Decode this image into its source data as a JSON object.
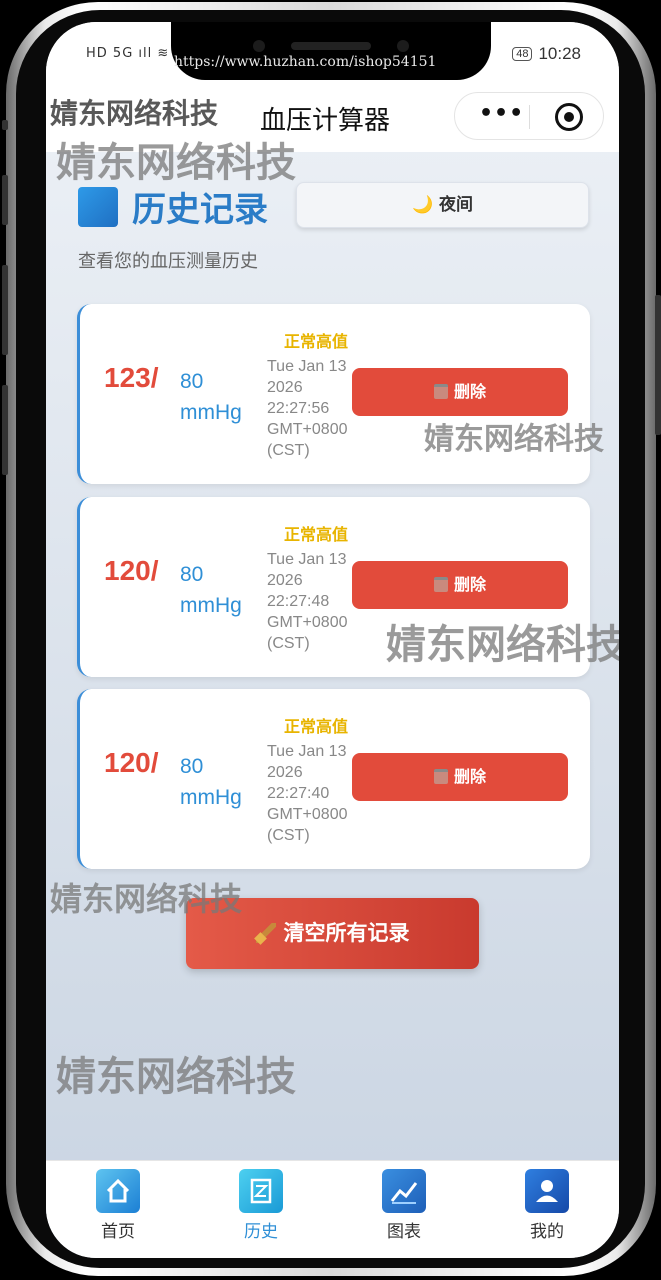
{
  "status_bar": {
    "left_icons": "HD 5G ıll ≋",
    "battery": "48",
    "time": "10:28"
  },
  "url_overlay": "https://www.huzhan.com/ishop54151",
  "app": {
    "brand_watermark": "婧东网络科技",
    "title": "血压计算器",
    "capsule_more": "•••"
  },
  "page": {
    "title": "历史记录",
    "night_toggle": "🌙 夜间",
    "subtitle": "查看您的血压测量历史"
  },
  "records": [
    {
      "systolic": "123/",
      "diastolic": "80",
      "unit": "mmHg",
      "status": "正常高值",
      "time": "Tue Jan 13 2026 22:27:56 GMT+0800 (CST)",
      "delete_label": "删除"
    },
    {
      "systolic": "120/",
      "diastolic": "80",
      "unit": "mmHg",
      "status": "正常高值",
      "time": "Tue Jan 13 2026 22:27:48 GMT+0800 (CST)",
      "delete_label": "删除"
    },
    {
      "systolic": "120/",
      "diastolic": "80",
      "unit": "mmHg",
      "status": "正常高值",
      "time": "Tue Jan 13 2026 22:27:40 GMT+0800 (CST)",
      "delete_label": "删除"
    }
  ],
  "clear_all_label": "清空所有记录",
  "tabs": [
    {
      "label": "首页",
      "icon": "home-icon",
      "active": false
    },
    {
      "label": "历史",
      "icon": "history-icon",
      "active": true
    },
    {
      "label": "图表",
      "icon": "chart-icon",
      "active": false
    },
    {
      "label": "我的",
      "icon": "profile-icon",
      "active": false
    }
  ],
  "colors": {
    "accent_blue": "#2f8fd6",
    "danger_red": "#e24b3b",
    "status_yellow": "#e8b400"
  }
}
